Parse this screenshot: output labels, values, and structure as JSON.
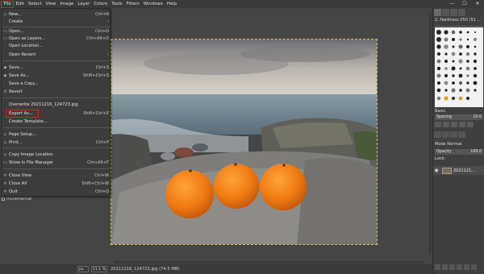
{
  "menubar": {
    "items": [
      "File",
      "Edit",
      "Select",
      "View",
      "Image",
      "Layer",
      "Colors",
      "Tools",
      "Filters",
      "Windows",
      "Help"
    ],
    "win_min": "—",
    "win_max": "☐",
    "win_close": "✕"
  },
  "file_menu": {
    "items": [
      {
        "label": "New...",
        "shortcut": "Ctrl+N"
      },
      {
        "label": "Create",
        "shortcut": "›"
      },
      {
        "label": "Open...",
        "shortcut": "Ctrl+O"
      },
      {
        "label": "Open as Layers...",
        "shortcut": "Ctrl+Alt+O"
      },
      {
        "label": "Open Location...",
        "shortcut": ""
      },
      {
        "label": "Open Recent",
        "shortcut": "›"
      },
      {
        "label": "Save...",
        "shortcut": "Ctrl+S"
      },
      {
        "label": "Save As...",
        "shortcut": "Shift+Ctrl+S"
      },
      {
        "label": "Save a Copy...",
        "shortcut": ""
      },
      {
        "label": "Revert",
        "shortcut": ""
      },
      {
        "label": "Overwrite 20211216_124723.jpg",
        "shortcut": ""
      },
      {
        "label": "Export As...",
        "shortcut": "Shift+Ctrl+E"
      },
      {
        "label": "Create Template...",
        "shortcut": ""
      },
      {
        "label": "Page Setup...",
        "shortcut": ""
      },
      {
        "label": "Print...",
        "shortcut": "Ctrl+P"
      },
      {
        "label": "Copy Image Location",
        "shortcut": ""
      },
      {
        "label": "Show in File Manager",
        "shortcut": "Ctrl+Alt+F"
      },
      {
        "label": "Close View",
        "shortcut": "Ctrl+W"
      },
      {
        "label": "Close All",
        "shortcut": "Shift+Ctrl+W"
      },
      {
        "label": "Quit",
        "shortcut": "Ctrl+Q"
      }
    ]
  },
  "left_dock": {
    "incremental": "Incremental"
  },
  "statusbar": {
    "unit": "px",
    "zoom": "11.1 %",
    "file": "20211216_124723.jpg (74.5 MB)"
  },
  "right_dock": {
    "brush_title": "2. Hardness 050 (51 ...",
    "brush_preset": "Basic.",
    "spacing_label": "Spacing",
    "spacing_value": "10.0",
    "mode": "Mode Normal",
    "opacity_label": "Opacity",
    "opacity_value": "100.0",
    "lock": "Lock:",
    "layer_name": "2021121..."
  },
  "colors": {
    "accent_red": "#e02020",
    "selection_marquee": "#d6c35a"
  }
}
